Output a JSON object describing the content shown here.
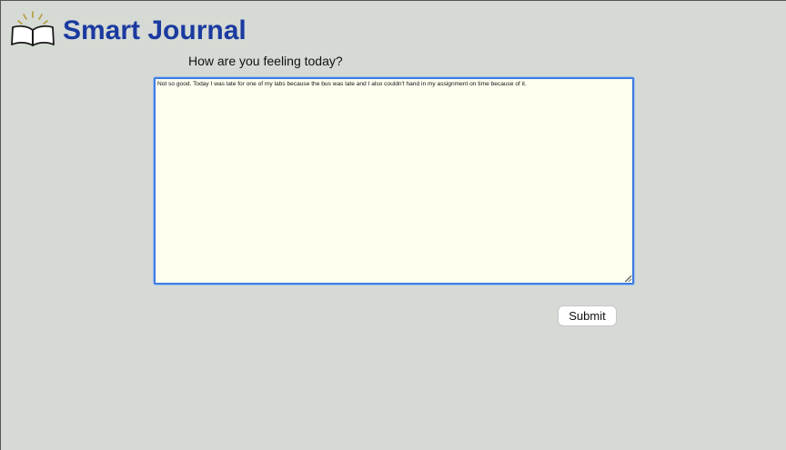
{
  "app": {
    "title": "Smart Journal",
    "logo_icon": "open-book-with-light-icon"
  },
  "journal": {
    "prompt": "How are you feeling today?",
    "entry_text": "Not so good. Today I was late for one of my labs because the bus was late and I also couldn't hand in my assignment on time because of it."
  },
  "actions": {
    "submit_label": "Submit"
  },
  "colors": {
    "background": "#d5dad4",
    "title": "#1b3aa0",
    "textarea_bg": "#fffff0",
    "focus_border": "#3d7de0"
  }
}
